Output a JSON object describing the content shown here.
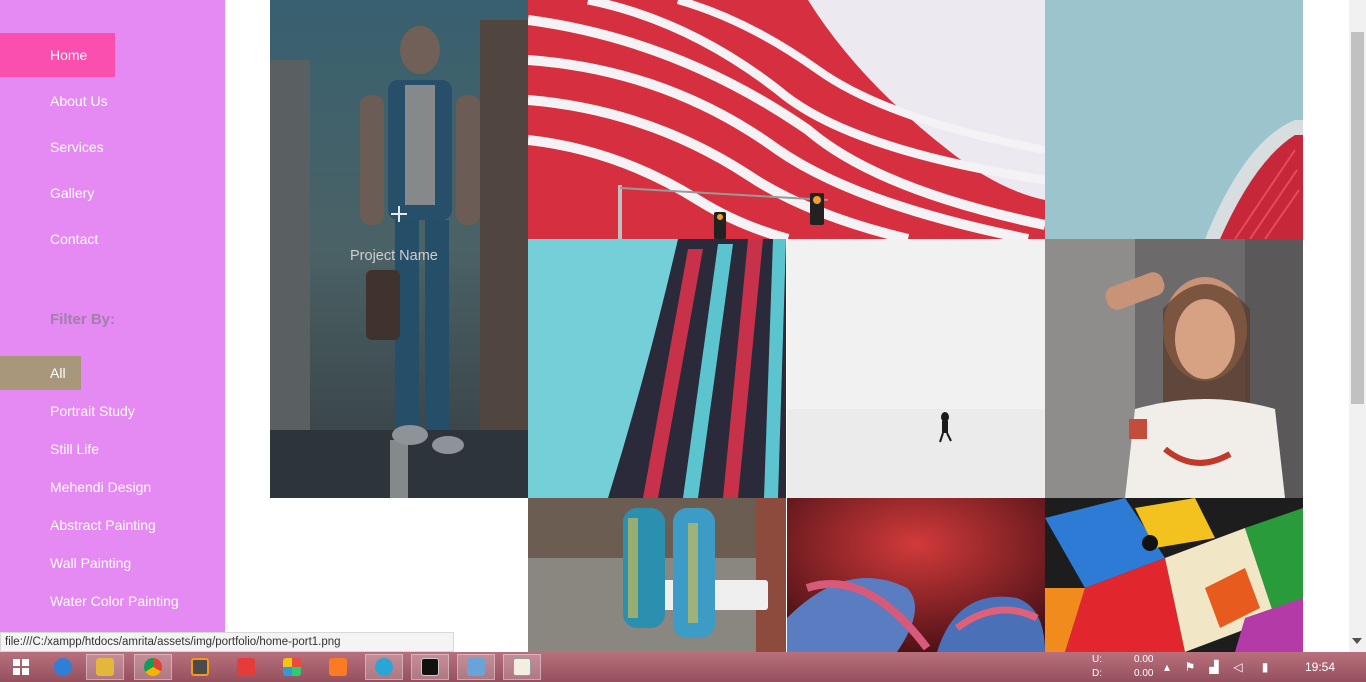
{
  "nav": {
    "items": [
      {
        "label": "Home",
        "active": true
      },
      {
        "label": "About Us"
      },
      {
        "label": "Services"
      },
      {
        "label": "Gallery"
      },
      {
        "label": "Contact"
      }
    ]
  },
  "filter": {
    "title": "Filter By:",
    "items": [
      {
        "label": "All",
        "active": true
      },
      {
        "label": "Portrait Study"
      },
      {
        "label": "Still Life"
      },
      {
        "label": "Mehendi Design"
      },
      {
        "label": "Abstract Painting"
      },
      {
        "label": "Wall Painting"
      },
      {
        "label": "Water Color Painting"
      }
    ]
  },
  "gallery": {
    "hover_caption": "Project Name"
  },
  "status_bar": {
    "url": "file:///C:/xampp/htdocs/amrita/assets/img/portfolio/home-port1.png"
  },
  "taskbar": {
    "net_up_label": "U:",
    "net_up_value": "0.00",
    "net_down_label": "D:",
    "net_down_value": "0.00",
    "clock": "19:54"
  },
  "colors": {
    "sidebar": "#e58af2",
    "active_nav": "#fb4fb0",
    "active_filter": "#a8977a",
    "taskbar": "#a65d6c"
  }
}
